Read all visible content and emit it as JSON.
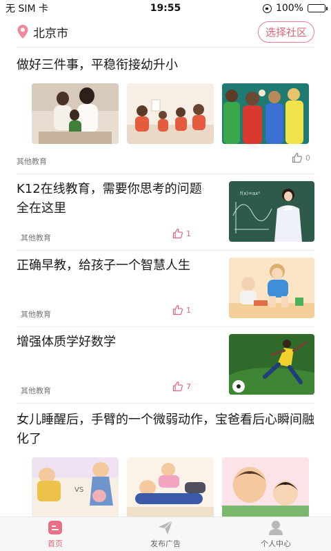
{
  "status_bar": {
    "carrier": "无 SIM 卡",
    "time": "19:55",
    "battery": "100%"
  },
  "header": {
    "city": "北京市",
    "community_button": "选择社区",
    "accent_color": "#e0657a"
  },
  "feed": [
    {
      "layout": "grid",
      "title": "做好三件事，平稳衔接幼升小",
      "tag": "其他教育",
      "likes": "0",
      "liked": false
    },
    {
      "layout": "side",
      "title": "K12在线教育，需要你思考的问题全在这里",
      "tag": "其他教育",
      "likes": "1",
      "liked": true
    },
    {
      "layout": "side",
      "title": "正确早教，给孩子一个智慧人生",
      "tag": "其他教育",
      "likes": "1",
      "liked": true
    },
    {
      "layout": "side",
      "title": "增强体质学好数学",
      "tag": "其他教育",
      "likes": "7",
      "liked": true
    },
    {
      "layout": "grid",
      "title": "女儿睡醒后，手臂的一个微弱动作，宝爸看后心瞬间融化了"
    }
  ],
  "tabbar": {
    "home": "首页",
    "post_ad": "发布广告",
    "profile": "个人中心"
  }
}
